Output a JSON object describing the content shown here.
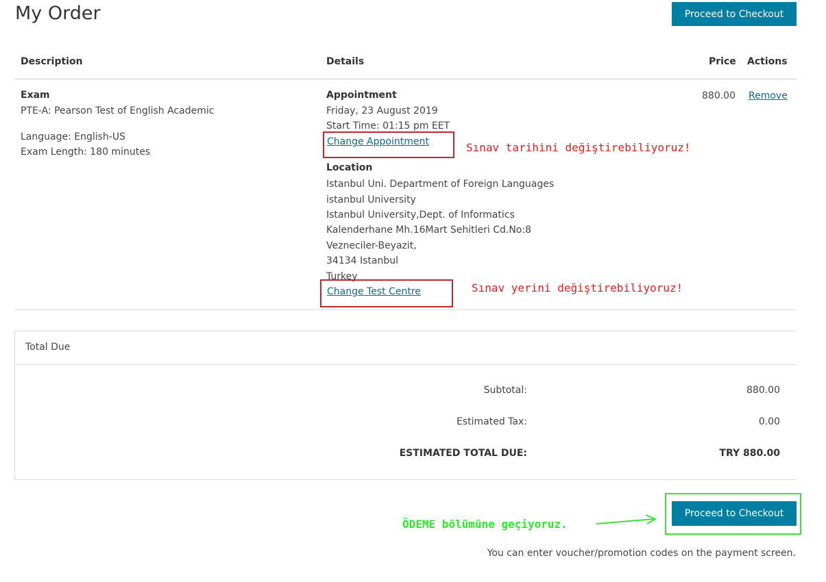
{
  "page": {
    "title": "My Order",
    "checkout_label": "Proceed to Checkout"
  },
  "table": {
    "headers": [
      "Description",
      "Details",
      "Price",
      "Actions"
    ]
  },
  "item": {
    "type": "Exam",
    "name": "PTE-A: Pearson Test of English Academic",
    "language": "Language: English-US",
    "length": "Exam Length: 180 minutes",
    "appointment_heading": "Appointment",
    "date": "Friday, 23 August 2019",
    "start_time": "Start Time: 01:15 pm EET",
    "change_appointment": "Change Appointment",
    "location_heading": "Location",
    "location_lines": [
      "Istanbul Uni. Department of Foreign Languages",
      "istanbul University",
      "Istanbul University,Dept. of Informatics",
      "Kalenderhane Mh.16Mart Sehitleri Cd.No:8",
      "Vezneciler-Beyazit,",
      "34134 Istanbul",
      "Turkey"
    ],
    "change_test_centre": "Change Test Centre",
    "price": "880.00",
    "remove": "Remove"
  },
  "annotations": {
    "appointment_note": "Sınav tarihini değiştirebiliyoruz!",
    "location_note": "Sınav yerini değiştirebiliyoruz!",
    "checkout_note": "ÖDEME bölümüne geçiyoruz."
  },
  "total": {
    "heading": "Total Due",
    "subtotal_label": "Subtotal:",
    "subtotal_value": "880.00",
    "tax_label": "Estimated Tax:",
    "tax_value": "0.00",
    "total_label": "ESTIMATED TOTAL DUE:",
    "total_value": "TRY 880.00"
  },
  "footer": {
    "voucher_note": "You can enter voucher/promotion codes on the payment screen."
  },
  "colors": {
    "button": "#007fa3",
    "link": "#006f8f",
    "red_annotation": "#c0272d",
    "green_annotation": "#39e239"
  }
}
